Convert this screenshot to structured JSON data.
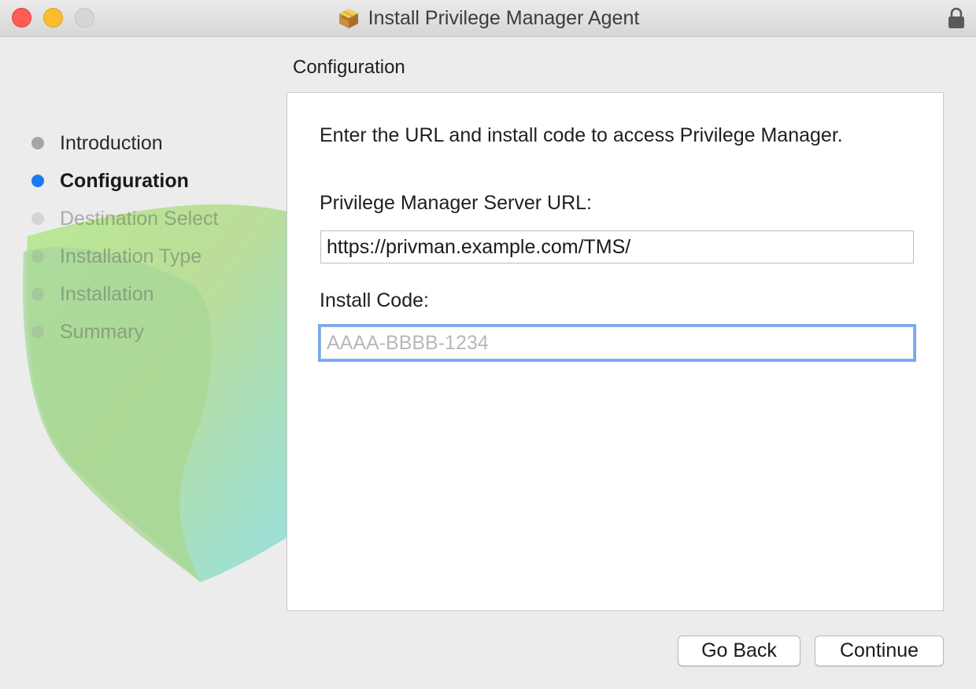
{
  "window": {
    "title": "Install Privilege Manager Agent",
    "icons": {
      "app": "package-icon",
      "lock": "lock-icon"
    }
  },
  "page": {
    "title": "Configuration"
  },
  "sidebar": {
    "steps": [
      {
        "label": "Introduction",
        "state": "done"
      },
      {
        "label": "Configuration",
        "state": "active"
      },
      {
        "label": "Destination Select",
        "state": "future"
      },
      {
        "label": "Installation Type",
        "state": "future"
      },
      {
        "label": "Installation",
        "state": "future"
      },
      {
        "label": "Summary",
        "state": "future"
      }
    ],
    "accent_color": "#1a7cf4"
  },
  "content": {
    "instruction": "Enter the URL and install code to access Privilege Manager.",
    "url_label": "Privilege Manager Server URL:",
    "url_value": "https://privman.example.com/TMS/",
    "code_label": "Install Code:",
    "code_value": "",
    "code_placeholder": "AAAA-BBBB-1234"
  },
  "buttons": {
    "back": "Go Back",
    "continue": "Continue"
  }
}
